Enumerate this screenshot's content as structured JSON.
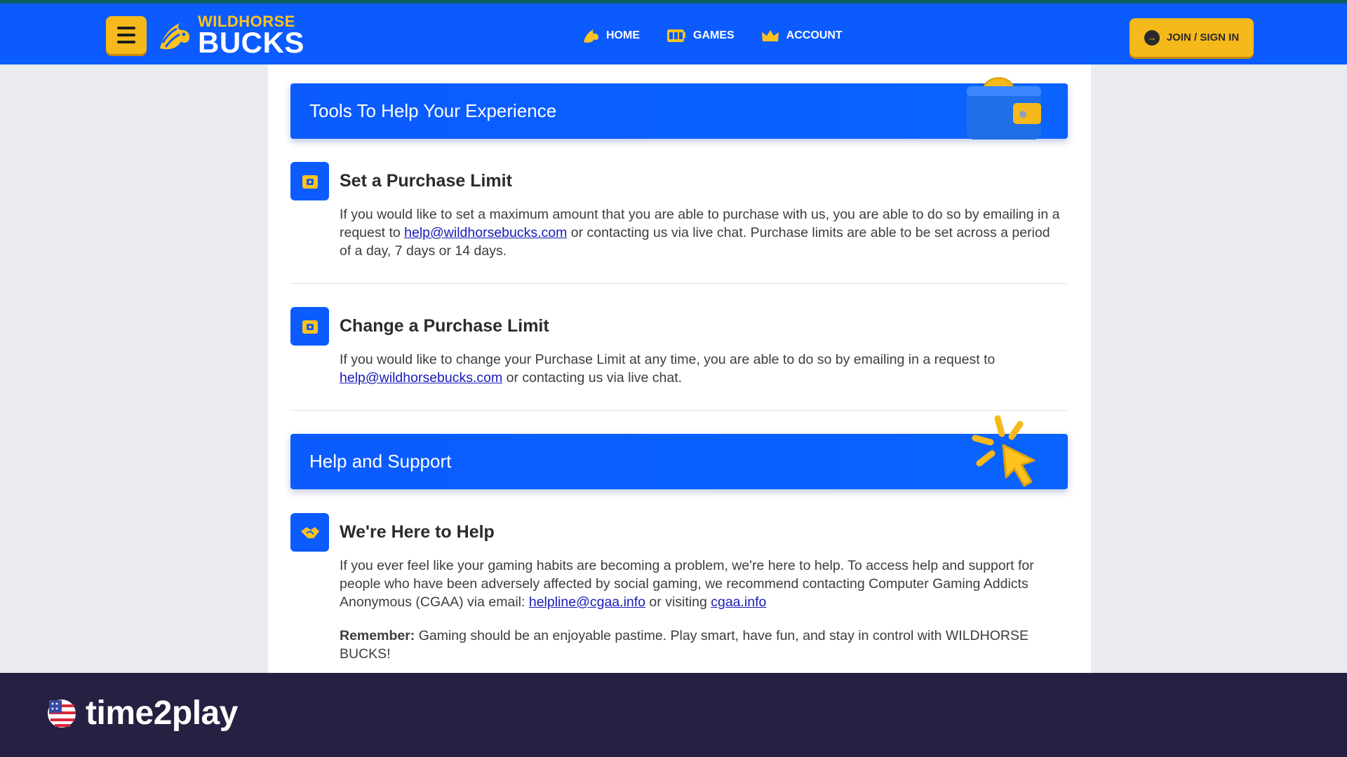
{
  "colors": {
    "primary_blue": "#0b5bff",
    "accent_yellow": "#f6b91b",
    "footer_bg": "#252142",
    "page_bg": "#e9ebf1"
  },
  "header": {
    "menu_icon": "hamburger-icon",
    "logo_top": "WILDHORSE",
    "logo_bottom": "BUCKS",
    "nav": [
      {
        "label": "HOME",
        "icon": "horse-head-icon"
      },
      {
        "label": "GAMES",
        "icon": "slot-machine-icon"
      },
      {
        "label": "ACCOUNT",
        "icon": "crown-icon"
      }
    ],
    "join_label": "JOIN / SIGN IN"
  },
  "tools_banner": {
    "title": "Tools To Help Your Experience",
    "illustration": "wallet-icon"
  },
  "set_limit": {
    "icon": "lock-box-icon",
    "title": "Set a Purchase Limit",
    "text_before": "If you would like to set a maximum amount that you are able to purchase with us, you are able to do so by emailing in a request to ",
    "link": "help@wildhorsebucks.com",
    "text_after": " or contacting us via live chat. Purchase limits are able to be set across a period of a day, 7 days or 14 days."
  },
  "change_limit": {
    "icon": "lock-box-icon",
    "title": "Change a Purchase Limit",
    "text_before": "If you would like to change your Purchase Limit at any time, you are able to do so by emailing in a request to ",
    "link": "help@wildhorsebucks.com",
    "text_after": " or contacting us via live chat."
  },
  "help_banner": {
    "title": "Help and Support",
    "illustration": "pointer-click-icon"
  },
  "here_to_help": {
    "icon": "handshake-icon",
    "title": "We're Here to Help",
    "text_before": "If you ever feel like your gaming habits are becoming a problem, we're here to help. To access help and support for people who have been adversely affected by social gaming, we recommend contacting Computer Gaming Addicts Anonymous (CGAA) via email: ",
    "link_email": "helpline@cgaa.info",
    "text_middle": " or visiting ",
    "link_site": "cgaa.info",
    "remember_label": "Remember:",
    "remember_text": " Gaming should be an enjoyable pastime. Play smart, have fun, and stay in control with WILDHORSE BUCKS!"
  },
  "footer": {
    "brand": "time2play",
    "brand_icon": "us-flag-icon"
  }
}
